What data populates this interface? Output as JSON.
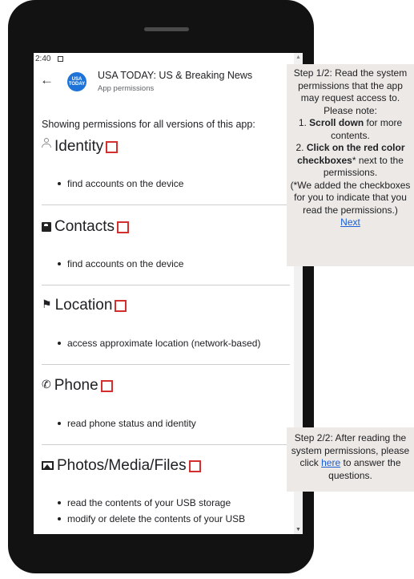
{
  "status_bar": {
    "time": "2:40"
  },
  "app_bar": {
    "logo_text": "USA TODAY",
    "title": "USA TODAY: US & Breaking News",
    "subtitle": "App permissions"
  },
  "content": {
    "intro": "Showing permissions for all versions of this app:",
    "permissions": [
      {
        "title": "Identity",
        "icon": "person-icon",
        "items": [
          "find accounts on the device"
        ]
      },
      {
        "title": "Contacts",
        "icon": "contact-card-icon",
        "items": [
          "find accounts on the device"
        ]
      },
      {
        "title": "Location",
        "icon": "location-pin-icon",
        "items": [
          "access approximate location (network-based)"
        ]
      },
      {
        "title": "Phone",
        "icon": "phone-icon",
        "items": [
          "read phone status and identity"
        ]
      },
      {
        "title": "Photos/Media/Files",
        "icon": "image-icon",
        "items": [
          "read the contents of your USB storage",
          "modify or delete the contents of your USB"
        ]
      }
    ]
  },
  "instructions": {
    "step1": {
      "line1": "Step 1/2: Read the system",
      "line2": "permissions that the app",
      "line3": "may request access to.",
      "line4": "Please note:",
      "line5_pre": "1. ",
      "line5_bold": "Scroll down",
      "line5_post": " for more",
      "line6": "contents.",
      "line7_pre": "2. ",
      "line7_bold": "Click on the red color",
      "line8_bold": "checkboxes",
      "line8_post": "* next to the",
      "line9": "permissions.",
      "line10": "(*We added the checkboxes",
      "line11": "for you to indicate that you",
      "line12": "read the permissions.)",
      "next_link": "Next"
    },
    "step2": {
      "line1": "Step 2/2: After reading the",
      "line2": "system permissions, please",
      "line3_pre": "click ",
      "line3_link": "here",
      "line3_post": " to answer the",
      "line4": "questions."
    }
  },
  "colors": {
    "checkbox_border": "#d32f2f",
    "link": "#1a5fd4",
    "panel_bg": "#ede9e6",
    "phone_frame": "#121212"
  }
}
